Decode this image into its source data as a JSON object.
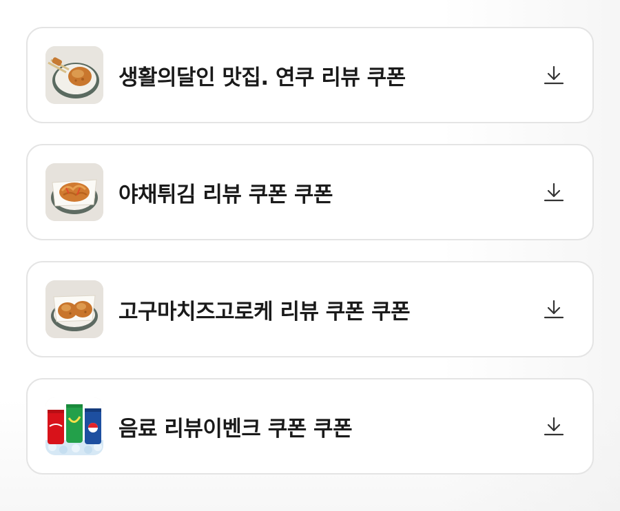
{
  "coupons": [
    {
      "title": "생활의달인 맛집. 연쿠 리뷰 쿠폰",
      "thumb_icon": "fried-croquette-plate-icon",
      "download_icon": "download-icon"
    },
    {
      "title": "야채튀김 리뷰 쿠폰 쿠폰",
      "thumb_icon": "vegetable-fritter-plate-icon",
      "download_icon": "download-icon"
    },
    {
      "title": "고구마치즈고로케 리뷰 쿠폰 쿠폰",
      "thumb_icon": "sweet-potato-croquette-plate-icon",
      "download_icon": "download-icon"
    },
    {
      "title": "음료 리뷰이벤크 쿠폰 쿠폰",
      "thumb_icon": "soda-cans-icon",
      "download_icon": "download-icon"
    }
  ],
  "colors": {
    "card_border": "#e4e4e4",
    "text": "#1a1a1a",
    "icon": "#333333",
    "fried_food": "#c9772e",
    "thumb_bg": "#e6e3de"
  }
}
